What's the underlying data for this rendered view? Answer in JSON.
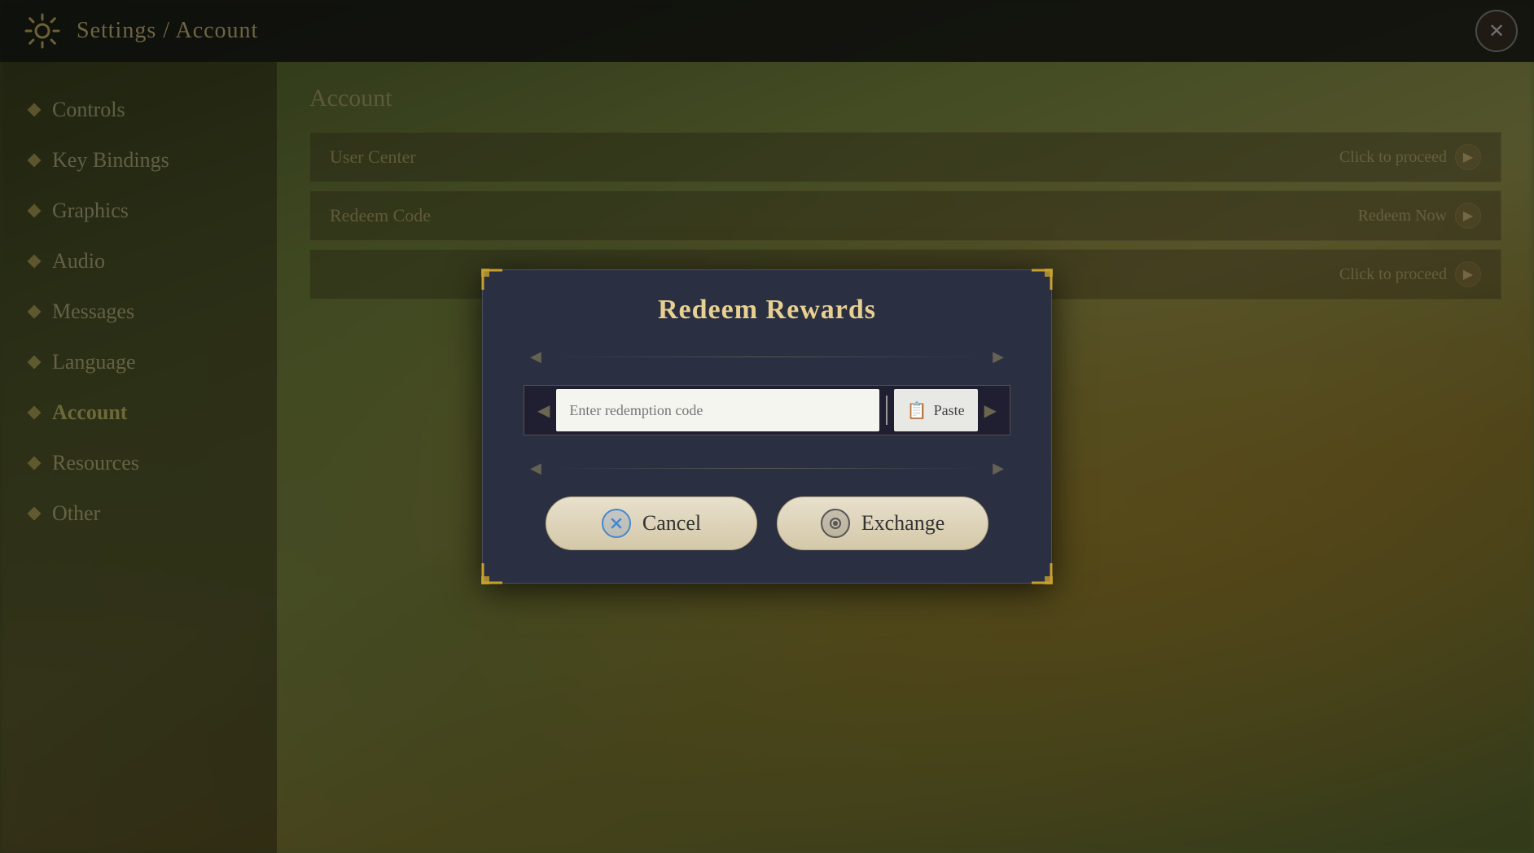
{
  "header": {
    "title": "Settings / Account",
    "close_label": "✕"
  },
  "sidebar": {
    "items": [
      {
        "id": "controls",
        "label": "Controls",
        "active": false
      },
      {
        "id": "key-bindings",
        "label": "Key Bindings",
        "active": false
      },
      {
        "id": "graphics",
        "label": "Graphics",
        "active": false
      },
      {
        "id": "audio",
        "label": "Audio",
        "active": false
      },
      {
        "id": "messages",
        "label": "Messages",
        "active": false
      },
      {
        "id": "language",
        "label": "Language",
        "active": false
      },
      {
        "id": "account",
        "label": "Account",
        "active": true
      },
      {
        "id": "resources",
        "label": "Resources",
        "active": false
      },
      {
        "id": "other",
        "label": "Other",
        "active": false
      }
    ]
  },
  "account_panel": {
    "title": "Account",
    "rows": [
      {
        "label": "User Center",
        "action": "Click to proceed"
      },
      {
        "label": "Redeem Code",
        "action": "Redeem Now"
      },
      {
        "label": "",
        "action": "Click to proceed"
      }
    ]
  },
  "dialog": {
    "title": "Redeem Rewards",
    "input_placeholder": "Enter redemption code",
    "paste_label": "Paste",
    "cancel_label": "Cancel",
    "exchange_label": "Exchange"
  }
}
